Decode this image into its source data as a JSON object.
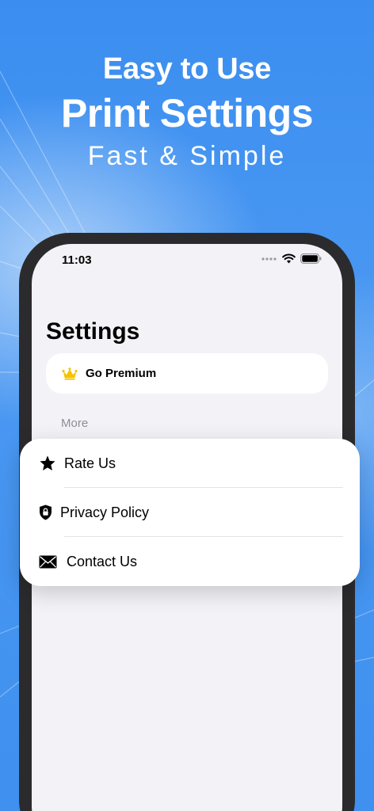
{
  "promo": {
    "line1": "Easy to Use",
    "line2": "Print Settings",
    "line3": "Fast & Simple"
  },
  "status_bar": {
    "time": "11:03"
  },
  "settings": {
    "title": "Settings",
    "premium_label": "Go Premium",
    "section_label": "More",
    "items": [
      {
        "label": "Rate Us",
        "icon": "star-icon"
      },
      {
        "label": "Privacy Policy",
        "icon": "shield-lock-icon"
      },
      {
        "label": "Contact Us",
        "icon": "envelope-icon"
      }
    ]
  },
  "colors": {
    "background": "#3b8ef0",
    "phone_frame": "#2b2b2d",
    "screen": "#f2f2f7",
    "crown": "#f5c400",
    "secondary_text": "#8e8e93"
  }
}
